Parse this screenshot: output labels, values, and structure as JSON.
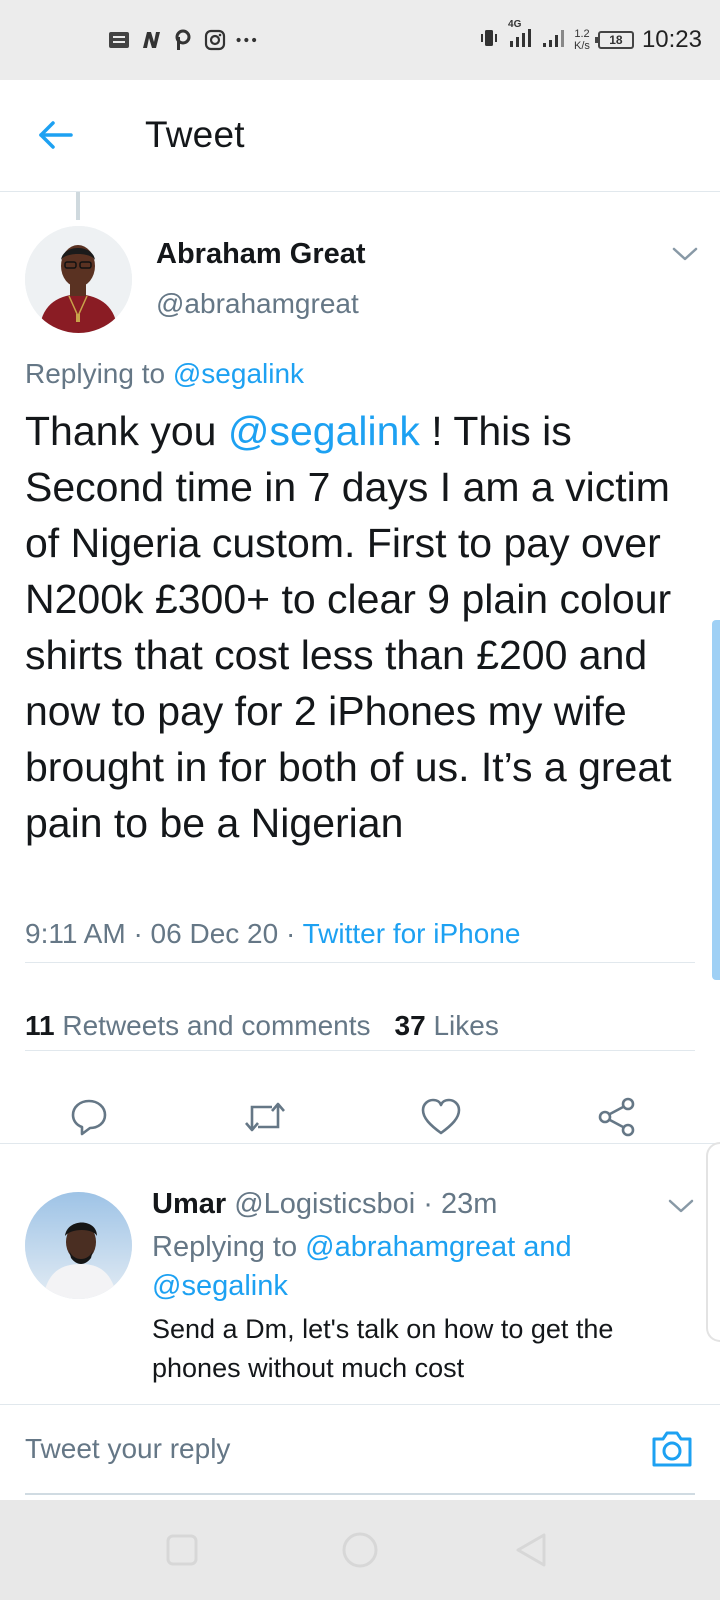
{
  "status_bar": {
    "time": "10:23",
    "network": "4G",
    "speed_value": "1.2",
    "speed_unit": "K/s",
    "battery": "18",
    "left_icons": [
      "notification-icon",
      "n-app-icon",
      "p-app-icon",
      "instagram-icon",
      "more-dots-icon"
    ]
  },
  "header": {
    "title": "Tweet"
  },
  "tweet": {
    "author_name": "Abraham Great",
    "author_handle": "@abrahamgreat",
    "replying_prefix": "Replying to",
    "replying_to": "@segalink",
    "text_before": "Thank you ",
    "text_mention": "@segalink",
    "text_after": " ! This is Second time in 7 days I am a victim of Nigeria custom. First to pay over N200k £300+ to clear 9 plain colour shirts that cost less than £200 and now to pay for 2 iPhones my wife brought in for both of us. It’s a great pain to be a Nigerian",
    "time": "9:11 AM",
    "date": "06 Dec 20",
    "source": "Twitter for iPhone",
    "retweets_count": "11",
    "retweets_label": "Retweets and comments",
    "likes_count": "37",
    "likes_label": "Likes"
  },
  "reply": {
    "name": "Umar",
    "handle": "@Logisticsboi",
    "time": "23m",
    "replying_prefix": "Replying to",
    "replying_to": "@abrahamgreat and @segalink",
    "text": "Send a Dm, let's talk on how to get the phones without much cost"
  },
  "composer": {
    "placeholder": "Tweet your reply"
  },
  "colors": {
    "accent": "#1da1f2",
    "secondary_text": "#657786",
    "primary_text": "#14171a",
    "divider": "#e1e8ed"
  },
  "icons": {
    "back": "arrow-left-icon",
    "caret": "chevron-down-icon",
    "reply": "comment-icon",
    "retweet": "retweet-icon",
    "like": "heart-icon",
    "share": "share-icon",
    "camera": "camera-icon"
  }
}
